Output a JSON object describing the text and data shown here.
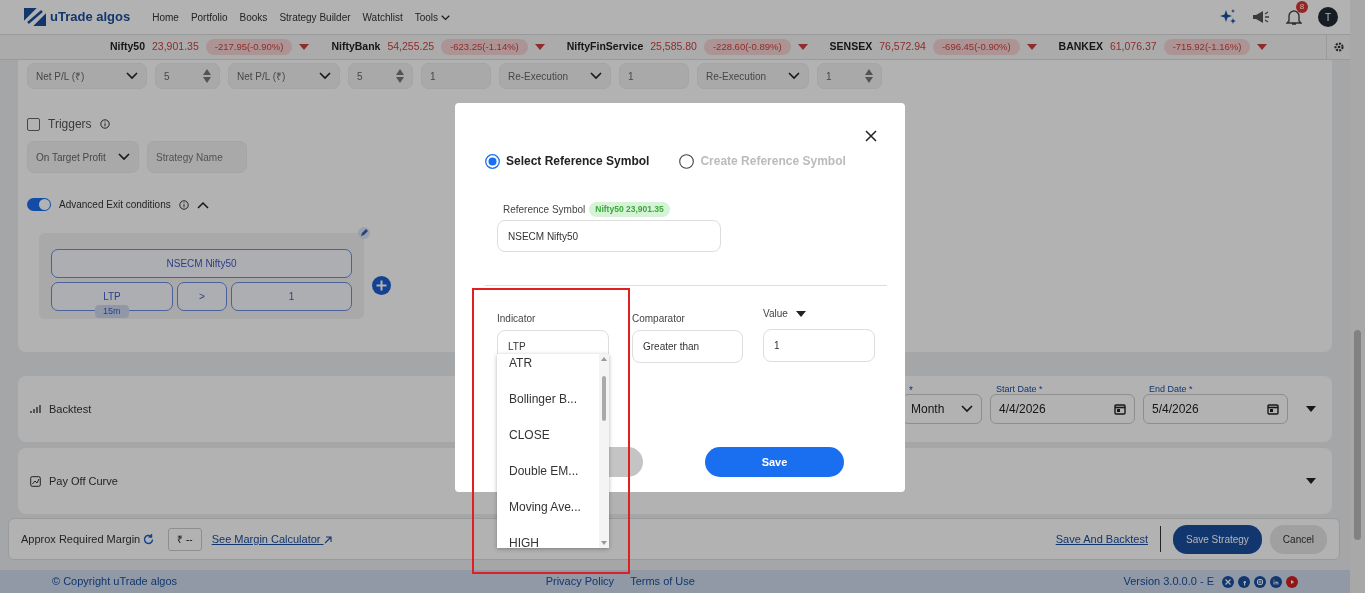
{
  "navbar": {
    "brand": "uTrade algos",
    "links": [
      {
        "label": "Home",
        "dropdown": false
      },
      {
        "label": "Portfolio",
        "dropdown": false
      },
      {
        "label": "Books",
        "dropdown": false
      },
      {
        "label": "Strategy Builder",
        "dropdown": false
      },
      {
        "label": "Watchlist",
        "dropdown": false
      },
      {
        "label": "Tools",
        "dropdown": true
      }
    ],
    "notification_count": "8",
    "avatar": "T"
  },
  "ticker": [
    {
      "name": "Nifty50",
      "price": "23,901.35",
      "change": "-217.95(-0.90%)"
    },
    {
      "name": "NiftyBank",
      "price": "54,255.25",
      "change": "-623.25(-1.14%)"
    },
    {
      "name": "NiftyFinService",
      "price": "25,585.80",
      "change": "-228.60(-0.89%)"
    },
    {
      "name": "SENSEX",
      "price": "76,572.94",
      "change": "-696.45(-0.90%)"
    },
    {
      "name": "BANKEX",
      "price": "61,076.37",
      "change": "-715.92(-1.16%)"
    }
  ],
  "exit_fields": [
    {
      "kind": "select",
      "value": "Net P/L (₹)"
    },
    {
      "kind": "spinner",
      "value": "5"
    },
    {
      "kind": "select",
      "value": "Net P/L (₹)"
    },
    {
      "kind": "spinner",
      "value": "5"
    },
    {
      "kind": "input",
      "value": "1"
    },
    {
      "kind": "select",
      "value": "Re-Execution"
    },
    {
      "kind": "input",
      "value": "1"
    },
    {
      "kind": "select",
      "value": "Re-Execution"
    },
    {
      "kind": "spinner",
      "value": "1"
    }
  ],
  "triggers": {
    "label": "Triggers",
    "checked": false,
    "target": "On Target Profit",
    "strategy_placeholder": "Strategy Name"
  },
  "advanced_exit": {
    "label": "Advanced Exit conditions",
    "on": true,
    "expanded": true,
    "condition": {
      "symbol": "NSECM Nifty50",
      "indicator": "LTP",
      "timeframe": "15m",
      "comparator": ">",
      "value": "1"
    }
  },
  "backtest": {
    "label": "Backtest",
    "period_label": "*",
    "period": "Month",
    "start_label": "Start Date *",
    "start": "4/4/2026",
    "end_label": "End Date *",
    "end": "5/4/2026"
  },
  "payoff": {
    "label": "Pay Off Curve"
  },
  "action_bar": {
    "margin_label": "Approx Required Margin",
    "margin_value": "₹ --",
    "calculator_link": "See Margin Calculator",
    "backtest_link": "Save And Backtest",
    "save": "Save Strategy",
    "cancel": "Cancel"
  },
  "footer": {
    "copyright": "© Copyright uTrade algos",
    "links": [
      "Privacy Policy",
      "Terms of Use"
    ],
    "version": "Version 3.0.0.0 - E"
  },
  "modal": {
    "modes": [
      {
        "label": "Select Reference Symbol",
        "selected": true
      },
      {
        "label": "Create Reference Symbol",
        "selected": false
      }
    ],
    "reference_label": "Reference Symbol",
    "reference_badge": "Nifty50 23,901.35",
    "reference_value": "NSECM Nifty50",
    "indicator_label": "Indicator",
    "indicator_value": "LTP",
    "comparator_label": "Comparator",
    "comparator_value": "Greater than",
    "value_label": "Value",
    "value": "1",
    "save": "Save",
    "indicator_options": [
      "ATR",
      "Bollinger B...",
      "CLOSE",
      "Double EM...",
      "Moving Ave...",
      "HIGH"
    ]
  }
}
